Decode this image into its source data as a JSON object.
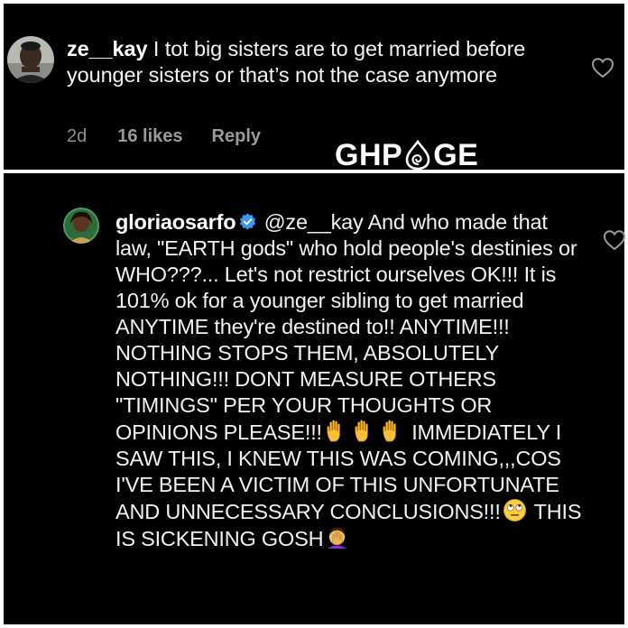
{
  "watermark": {
    "text_before": "GHP",
    "text_after": "GE",
    "icon": "drop-swirl-icon"
  },
  "top_comment": {
    "username": "ze__kay",
    "text": "I tot big sisters are to get married before younger sisters or that’s not the case anymore",
    "time": "2d",
    "likes": "16 likes",
    "reply_label": "Reply",
    "like_icon": "heart-outline-icon"
  },
  "reply_comment": {
    "username": "gloriaosarfo",
    "verified_icon": "verified-badge-icon",
    "verified_color": "#3897f0",
    "text_part1": "@ze__kay And who made that law, \"EARTH gods\" who hold people's destinies or WHO???... Let's not restrict ourselves OK!!! It is 101% ok for a younger sibling to get married ANYTIME they're destined to!! ANYTIME!!! NOTHING STOPS THEM, ABSOLUTELY NOTHING!!! DONT MEASURE OTHERS \"TIMINGS\" PER YOUR THOUGHTS OR OPINIONS PLEASE!!!",
    "emoji_hands": [
      "raised-hand-emoji",
      "raised-hand-emoji",
      "raised-hand-emoji"
    ],
    "text_part2": "IMMEDIATELY I SAW THIS, I KNEW THIS WAS COMING,,,COS I'VE BEEN A VICTIM OF THIS UNFORTUNATE AND UNNECESSARY CONCLUSIONS!!!",
    "emoji_eyes": "eye-roll-emoji",
    "text_part3": "THIS IS SICKENING GOSH",
    "emoji_facepalm": "facepalm-emoji",
    "like_icon": "heart-outline-icon"
  }
}
